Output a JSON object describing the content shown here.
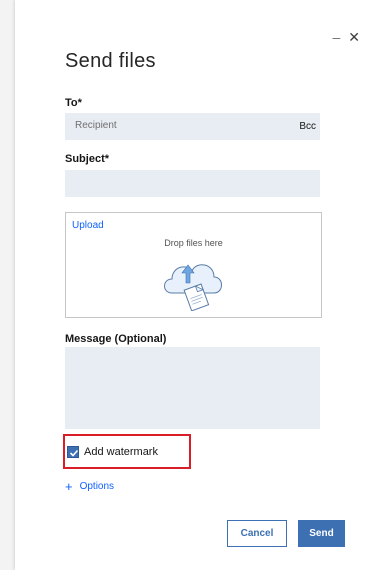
{
  "window": {
    "minimize_glyph": "–",
    "close_glyph": "✕"
  },
  "dialog": {
    "title": "Send files"
  },
  "to": {
    "label": "To*",
    "placeholder": "Recipient",
    "bcc_label": "Bcc"
  },
  "subject": {
    "label": "Subject*",
    "value": ""
  },
  "upload": {
    "link_label": "Upload",
    "drop_text": "Drop files here",
    "icon": "cloud-upload-icon"
  },
  "message": {
    "label": "Message (Optional)",
    "value": ""
  },
  "watermark": {
    "label": "Add watermark",
    "checked": true
  },
  "options": {
    "label": "Options",
    "icon": "plus-icon"
  },
  "buttons": {
    "cancel": "Cancel",
    "send": "Send"
  },
  "colors": {
    "accent": "#3d70b2",
    "link": "#0f62fe",
    "field_bg": "#e8edf3",
    "highlight": "#da1e28"
  }
}
